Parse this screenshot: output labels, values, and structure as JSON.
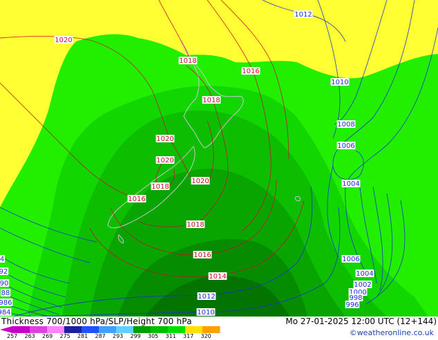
{
  "header": {
    "title": "Thickness 700/1000 hPa/SLP/Height 700 hPa",
    "valid_time": "Mo 27-01-2025 12:00 UTC (12+144)",
    "credit": "©weatheronline.co.uk"
  },
  "legend": {
    "ticks": [
      "257",
      "263",
      "269",
      "275",
      "281",
      "287",
      "293",
      "299",
      "305",
      "311",
      "317",
      "320"
    ],
    "colors": [
      "#c800c8",
      "#e040e0",
      "#ff80ff",
      "#1e1ea0",
      "#2050ff",
      "#40a0ff",
      "#60d0ff",
      "#00a000",
      "#00c000",
      "#00e000",
      "#ffe000",
      "#ffa000"
    ]
  },
  "map": {
    "fill_colors": {
      "yellow": "#ffff33",
      "green_1": "#22ee00",
      "green_2": "#11d600",
      "green_3": "#0cbd00",
      "green_4": "#08a400",
      "green_5": "#058c00",
      "green_6": "#037400"
    },
    "isobar_labels": [
      {
        "text": "1012",
        "color": "blue"
      },
      {
        "text": "1020",
        "color": "red"
      },
      {
        "text": "1018",
        "color": "red"
      },
      {
        "text": "1016",
        "color": "red"
      },
      {
        "text": "1010",
        "color": "blue"
      },
      {
        "text": "1018",
        "color": "red"
      },
      {
        "text": "1008",
        "color": "blue"
      },
      {
        "text": "1006",
        "color": "blue"
      },
      {
        "text": "1020",
        "color": "red"
      },
      {
        "text": "1020",
        "color": "red"
      },
      {
        "text": "1004",
        "color": "blue"
      },
      {
        "text": "1020",
        "color": "red"
      },
      {
        "text": "1018",
        "color": "red"
      },
      {
        "text": "1016",
        "color": "red"
      },
      {
        "text": "1018",
        "color": "red"
      },
      {
        "text": "1016",
        "color": "red"
      },
      {
        "text": "1006",
        "color": "blue"
      },
      {
        "text": "1014",
        "color": "red"
      },
      {
        "text": "1004",
        "color": "blue"
      },
      {
        "text": "1002",
        "color": "blue"
      },
      {
        "text": "1000",
        "color": "blue"
      },
      {
        "text": "998",
        "color": "blue"
      },
      {
        "text": "996",
        "color": "blue"
      },
      {
        "text": "1012",
        "color": "blue"
      },
      {
        "text": "1010",
        "color": "blue"
      },
      {
        "text": "4",
        "color": "blue"
      },
      {
        "text": "92",
        "color": "blue"
      },
      {
        "text": "90",
        "color": "blue"
      },
      {
        "text": "88",
        "color": "blue"
      },
      {
        "text": "986",
        "color": "blue"
      },
      {
        "text": "984",
        "color": "blue"
      }
    ]
  }
}
